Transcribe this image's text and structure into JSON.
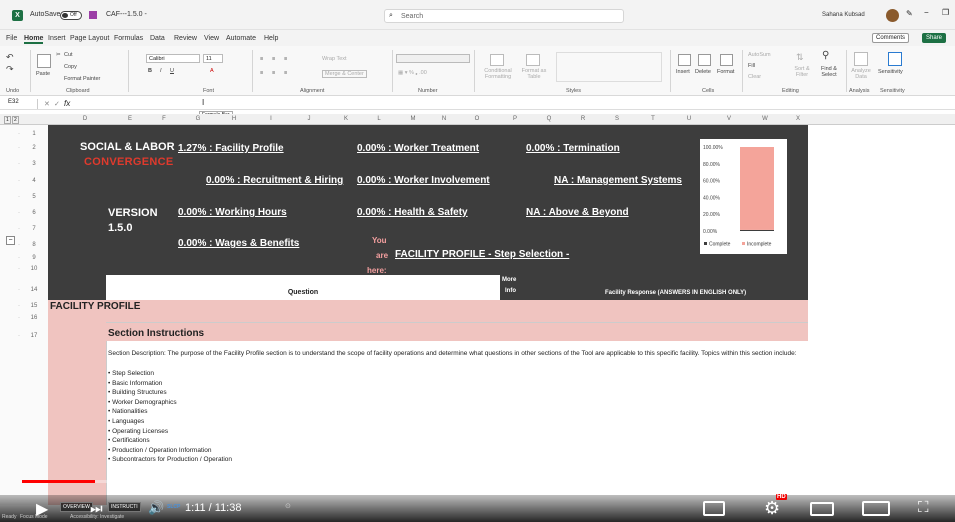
{
  "titlebar": {
    "autosave": "AutoSave",
    "toggle": "Off",
    "filename": "CAF---1.5.0 -",
    "search_placeholder": "Search",
    "user": "Sahana Kubsad"
  },
  "menu": {
    "items": [
      "File",
      "Home",
      "Insert",
      "Page Layout",
      "Formulas",
      "Data",
      "Review",
      "View",
      "Automate",
      "Help"
    ],
    "comments": "Comments",
    "share": "Share"
  },
  "ribbon": {
    "undo": "Undo",
    "paste": "Paste",
    "cut": "Cut",
    "copy": "Copy",
    "format_painter": "Format Painter",
    "clipboard": "Clipboard",
    "font_name": "Calibri",
    "font_size": "11",
    "font": "Font",
    "wrap_text": "Wrap Text",
    "merge_center": "Merge & Center",
    "alignment": "Alignment",
    "number": "Number",
    "conditional": "Conditional Formatting",
    "format_as": "Format as Table",
    "styles": "Styles",
    "insert": "Insert",
    "delete": "Delete",
    "format": "Format",
    "cells": "Cells",
    "autosum": "AutoSum",
    "fill": "Fill",
    "clear": "Clear",
    "sort": "Sort & Filter",
    "find": "Find & Select",
    "editing": "Editing",
    "analyze": "Analyze Data",
    "analysis": "Analysis",
    "sensitivity": "Sensitivity",
    "sensitivity_grp": "Sensitivity"
  },
  "formula": {
    "namebox": "E32",
    "fx": "fx",
    "tooltip": "Formula Bar"
  },
  "columns": [
    "D",
    "E",
    "F",
    "G",
    "H",
    "I",
    "J",
    "K",
    "L",
    "M",
    "N",
    "O",
    "P",
    "Q",
    "R",
    "S",
    "T",
    "U",
    "V",
    "W",
    "X"
  ],
  "rows": [
    "1",
    "2",
    "3",
    "4",
    "5",
    "6",
    "7",
    "8",
    "9",
    "10",
    "14",
    "15",
    "16",
    "17"
  ],
  "sheet": {
    "title1": "SOCIAL & LABOR",
    "title2": "CONVERGENCE",
    "version1": "VERSION",
    "version2": "1.5.0",
    "links": [
      "1.27% : Facility Profile",
      "0.00% : Worker Treatment",
      "0.00% : Termination",
      "0.00% : Recruitment & Hiring",
      "0.00% : Worker Involvement",
      "NA : Management Systems",
      "0.00% : Working Hours",
      "0.00% : Health & Safety",
      "NA : Above & Beyond",
      "0.00% : Wages & Benefits"
    ],
    "you1": "You",
    "you2": "are",
    "you3": "here:",
    "current": "FACILITY PROFILE - Step Selection -",
    "question": "Question",
    "more1": "More",
    "more2": "Info",
    "facility_response": "Facility Response (ANSWERS IN ENGLISH ONLY)",
    "section_header": "FACILITY PROFILE",
    "instructions": "Section Instructions",
    "description": "Section Description: The purpose of the Facility Profile section is to understand the scope of facility operations and determine what questions in other sections of the Tool are applicable to this specific facility. Topics within this section include:",
    "bullets": [
      "• Step Selection",
      "• Basic Information",
      "• Building Structures",
      "• Worker Demographics",
      "• Nationalities",
      "• Languages",
      "• Operating Licenses",
      "• Certifications",
      "• Production / Operation Information",
      "• Subcontractors for Production / Operation"
    ]
  },
  "chart_data": {
    "type": "bar",
    "categories": [
      ""
    ],
    "series": [
      {
        "name": "Complete",
        "values": [
          1.27
        ],
        "color": "#3d3d3d"
      },
      {
        "name": "Incomplete",
        "values": [
          98.73
        ],
        "color": "#f4a49a"
      }
    ],
    "stacked": true,
    "yticks": [
      "100.00%",
      "80.00%",
      "60.00%",
      "40.00%",
      "20.00%",
      "0.00%"
    ],
    "ylim": [
      0,
      100
    ],
    "legend": [
      "Complete",
      "Incomplete"
    ]
  },
  "player": {
    "time": "1:11 / 11:38",
    "chapter1": "OVERVIEW",
    "chapter2": "INSTRUCTI",
    "chapter3": "SLCP",
    "hd": "HD",
    "status": "Ready",
    "accessibility": "Accessibility: Investigate",
    "focus": "Focus Mode"
  }
}
